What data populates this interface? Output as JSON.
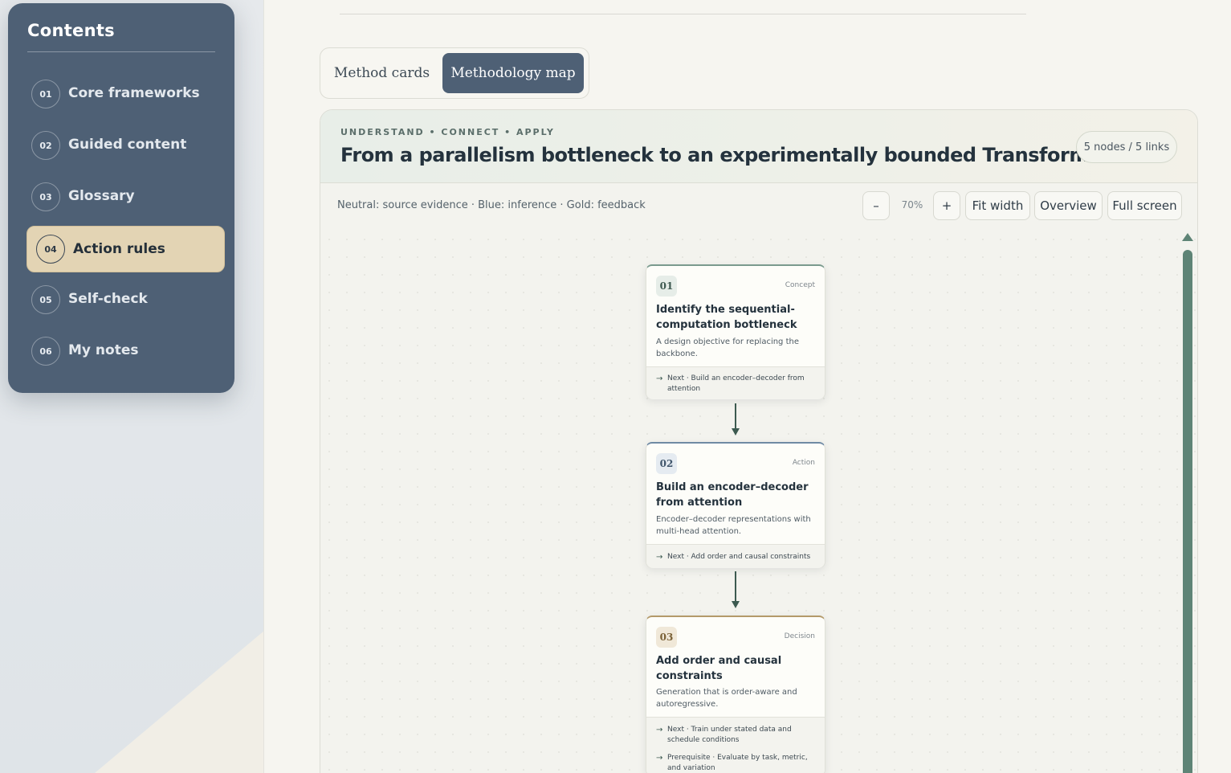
{
  "sidebar": {
    "title": "Contents",
    "items": [
      {
        "num": "01",
        "label": "Core frameworks"
      },
      {
        "num": "02",
        "label": "Guided content"
      },
      {
        "num": "03",
        "label": "Glossary"
      },
      {
        "num": "04",
        "label": "Action rules"
      },
      {
        "num": "05",
        "label": "Self-check"
      },
      {
        "num": "06",
        "label": "My notes"
      }
    ],
    "active_index": 3
  },
  "view_switch": {
    "options": [
      "Method cards",
      "Methodology map"
    ],
    "selected": "Methodology map"
  },
  "map": {
    "eyebrow": "UNDERSTAND • CONNECT • APPLY",
    "title": "From a parallelism bottleneck to an experimentally bounded Transformer",
    "count_badge": "5 nodes / 5 links",
    "legend": "Neutral: source evidence · Blue: inference · Gold: feedback",
    "toolbar": {
      "zoom_out": "–",
      "zoom_level": "70%",
      "zoom_in": "+",
      "fit_width": "Fit width",
      "overview": "Overview",
      "full_screen": "Full screen"
    },
    "nodes": [
      {
        "index": "01",
        "type": "Concept",
        "title": "Identify the sequential-computation bottleneck",
        "description": "A design objective for replacing the backbone.",
        "links": [
          {
            "text": "Next · Build an encoder–decoder from attention"
          }
        ]
      },
      {
        "index": "02",
        "type": "Action",
        "title": "Build an encoder–decoder from attention",
        "description": "Encoder–decoder representations with multi-head attention.",
        "links": [
          {
            "text": "Next · Add order and causal constraints"
          }
        ]
      },
      {
        "index": "03",
        "type": "Decision",
        "title": "Add order and causal constraints",
        "description": "Generation that is order-aware and autoregressive.",
        "links": [
          {
            "text": "Next · Train under stated data and schedule conditions"
          },
          {
            "text": "Prerequisite · Evaluate by task, metric, and variation"
          }
        ]
      }
    ]
  },
  "colors": {
    "sidebar_bg": "#4e6075",
    "active_nav": "#e3d4b4",
    "accent_green": "#5e8476",
    "concept": "#7a9a8d",
    "action": "#6f8aa4",
    "decision": "#b49a6a"
  },
  "icons": {
    "link_arrow": "arrow-right-icon",
    "scroll_up": "triangle-up-icon"
  }
}
